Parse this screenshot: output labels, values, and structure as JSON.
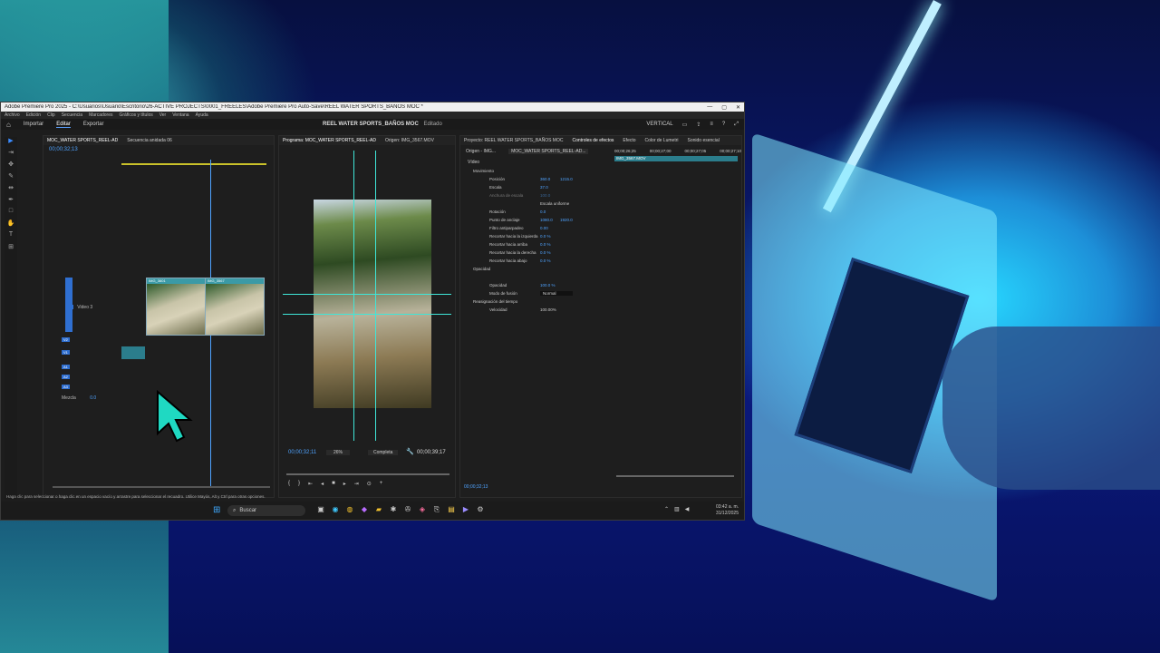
{
  "window": {
    "title": "Adobe Premiere Pro 2025 - C:\\Usuarios\\Usuario\\Escritorio\\26-ACTIVE PROJECTS\\0001_FREELES\\Adobe Premiere Pro Auto-Save\\REEL WATER SPORTS_BAÑOS MOC *",
    "controls": [
      "—",
      "▢",
      "✕"
    ]
  },
  "menubar": [
    "Archivo",
    "Edición",
    "Clip",
    "Secuencia",
    "Marcadores",
    "Gráficos y títulos",
    "Ver",
    "Ventana",
    "Ayuda"
  ],
  "workspace": {
    "tabs": [
      "Importar",
      "Editar",
      "Exportar"
    ],
    "active": "Editar",
    "project_title": "REEL WATER SPORTS_BAÑOS MOC",
    "project_status": "Editado",
    "layout_label": "VERTICAL"
  },
  "timeline": {
    "tabs": [
      "MOC_WATER SPORTS_REEL-AD",
      "Secuencia anidada 06"
    ],
    "timecode": "00;00;32;13",
    "tracks": [
      {
        "id": "V3",
        "name": "Video 3"
      },
      {
        "id": "V2",
        "name": ""
      },
      {
        "id": "V1",
        "name": ""
      },
      {
        "id": "A1",
        "name": ""
      },
      {
        "id": "A2",
        "name": ""
      },
      {
        "id": "A3",
        "name": ""
      }
    ],
    "clip_labels": [
      "IMG_3601",
      "IMG_3567"
    ],
    "mix_label": "Mezcla",
    "mix_value": "0.0"
  },
  "program": {
    "tabs": [
      "Programa: MOC_WATER SPORTS_REEL-AD",
      "Origen: IMG_3567.MOV"
    ],
    "timecode_current": "00;00;32;11",
    "zoom": "26%",
    "quality": "Completa",
    "timecode_total": "00;00;39;17"
  },
  "effects": {
    "tabs": [
      "Proyecto: REEL WATER SPORTS_BAÑOS MOC",
      "Controles de efectos",
      "Efecto",
      "Color de Lumetri",
      "Sonido esencial"
    ],
    "active": "Controles de efectos",
    "source_label": "Origen - IMG...",
    "seq_label": "MOC_WATER SPORTS_REEL-AD...",
    "timecodes": [
      "00;00;26;25",
      "00;00;27;00",
      "00;00;27;05",
      "00;00;27;10"
    ],
    "clip_name": "IMG_3567.MOV",
    "section_video": "Vídeo",
    "rows": [
      {
        "label": "Movimiento",
        "v1": "",
        "v2": ""
      },
      {
        "label": "Posición",
        "v1": "360.0",
        "v2": "1215.0"
      },
      {
        "label": "Escala",
        "v1": "37.0",
        "v2": ""
      },
      {
        "label": "Anchura de escala",
        "v1": "100.0",
        "v2": ""
      },
      {
        "label": "Escala uniforme",
        "v1": "",
        "v2": ""
      },
      {
        "label": "Rotación",
        "v1": "0.0",
        "v2": ""
      },
      {
        "label": "Punto de anclaje",
        "v1": "1080.0",
        "v2": "1920.0"
      },
      {
        "label": "Filtro antiparpadeo",
        "v1": "0.00",
        "v2": ""
      },
      {
        "label": "Recortar hacia la izquierda",
        "v1": "0.0 %",
        "v2": ""
      },
      {
        "label": "Recortar hacia arriba",
        "v1": "0.0 %",
        "v2": ""
      },
      {
        "label": "Recortar hacia la derecha",
        "v1": "0.0 %",
        "v2": ""
      },
      {
        "label": "Recortar hacia abajo",
        "v1": "0.0 %",
        "v2": ""
      },
      {
        "label": "Opacidad",
        "v1": "",
        "v2": ""
      },
      {
        "label": "Opacidad",
        "v1": "100.0 %",
        "v2": ""
      },
      {
        "label": "Modo de fusión",
        "v1": "Normal",
        "v2": ""
      },
      {
        "label": "Reasignación del tiempo",
        "v1": "",
        "v2": ""
      },
      {
        "label": "Velocidad",
        "v1": "100.00%",
        "v2": ""
      }
    ],
    "bottom_timecode": "00;00;32;13"
  },
  "statusbar": "Haga clic para seleccionar o haga clic en un espacio vacío y arrastre para seleccionar el recuadro. Utilice Mayús, Alt y Ctrl para otras opciones.",
  "taskbar": {
    "search_placeholder": "Buscar",
    "time": "03:42 a. m.",
    "date": "31/12/2025"
  },
  "colors": {
    "accent": "#4fa3ff",
    "guide": "#3fe6d8",
    "clip": "#3b9aa6",
    "cursor": "#1fd9c2"
  }
}
